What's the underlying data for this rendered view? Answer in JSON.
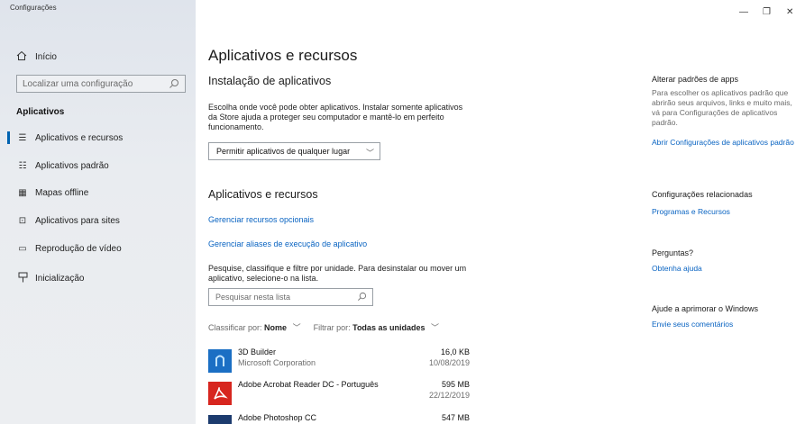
{
  "window": {
    "title": "Configurações",
    "minimize": "—",
    "maximize": "❐",
    "close": "✕"
  },
  "sidebar": {
    "home_label": "Início",
    "search_placeholder": "Localizar uma configuração",
    "section_heading": "Aplicativos",
    "items": [
      {
        "label": "Aplicativos e recursos",
        "icon": "apps-features-icon"
      },
      {
        "label": "Aplicativos padrão",
        "icon": "default-apps-icon"
      },
      {
        "label": "Mapas offline",
        "icon": "offline-maps-icon"
      },
      {
        "label": "Aplicativos para sites",
        "icon": "apps-websites-icon"
      },
      {
        "label": "Reprodução de vídeo",
        "icon": "video-playback-icon"
      },
      {
        "label": "Inicialização",
        "icon": "startup-icon"
      }
    ]
  },
  "main": {
    "title": "Aplicativos e recursos",
    "install": {
      "heading": "Instalação de aplicativos",
      "description": "Escolha onde você pode obter aplicativos. Instalar somente aplicativos da Store ajuda a proteger seu computador e mantê-lo em perfeito funcionamento.",
      "dropdown_value": "Permitir aplicativos de qualquer lugar"
    },
    "apps": {
      "heading": "Aplicativos e recursos",
      "link_optional": "Gerenciar recursos opcionais",
      "link_aliases": "Gerenciar aliases de execução de aplicativo",
      "description": "Pesquise, classifique e filtre por unidade. Para desinstalar ou mover um aplicativo, selecione-o na lista.",
      "search_placeholder": "Pesquisar nesta lista",
      "sort_label": "Classificar por:",
      "sort_value": "Nome",
      "filter_label": "Filtrar por:",
      "filter_value": "Todas as unidades",
      "list": [
        {
          "name": "3D Builder",
          "publisher": "Microsoft Corporation",
          "size": "16,0 KB",
          "date": "10/08/2019",
          "icon_color": "#1b6fc4"
        },
        {
          "name": "Adobe Acrobat Reader DC - Português",
          "publisher": "",
          "size": "595 MB",
          "date": "22/12/2019",
          "icon_color": "#d7261f"
        },
        {
          "name": "Adobe Photoshop CC",
          "publisher": "",
          "size": "547 MB",
          "date": "",
          "icon_color": "#1c3b6e"
        }
      ]
    }
  },
  "right": {
    "defaults_heading": "Alterar padrões de apps",
    "defaults_text": "Para escolher os aplicativos padrão que abrirão seus arquivos, links e muito mais, vá para Configurações de aplicativos padrão.",
    "defaults_link": "Abrir Configurações de aplicativos padrão",
    "related_heading": "Configurações relacionadas",
    "related_link": "Programas e Recursos",
    "questions_heading": "Perguntas?",
    "questions_link": "Obtenha ajuda",
    "improve_heading": "Ajude a aprimorar o Windows",
    "improve_link": "Envie seus comentários"
  },
  "colors": {
    "accent": "#0063b1",
    "link": "#0a64c2",
    "sidebar_bg": "#e6e9ee"
  }
}
